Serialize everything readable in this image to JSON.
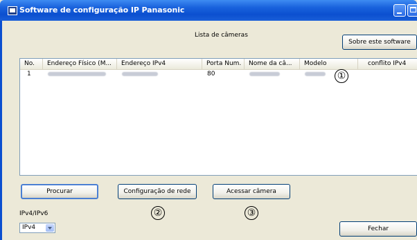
{
  "window": {
    "title": "Software de configuração IP Panasonic"
  },
  "header": {
    "list_title": "Lista de câmeras",
    "about_button": "Sobre este software"
  },
  "table": {
    "columns": [
      "No.",
      "Endereço Físico (M...",
      "Endereço IPv4",
      "Porta Num.",
      "Nome da câ...",
      "Modelo",
      "conflito IPv4"
    ],
    "rows": [
      {
        "no": "1",
        "port": "80"
      }
    ]
  },
  "buttons": {
    "search": "Procurar",
    "network_config": "Configuração de rede",
    "access_camera": "Acessar câmera",
    "close": "Fechar"
  },
  "ip_version": {
    "label": "IPv4/IPv6",
    "selected": "IPv4"
  },
  "callouts": [
    "①",
    "②",
    "③"
  ]
}
